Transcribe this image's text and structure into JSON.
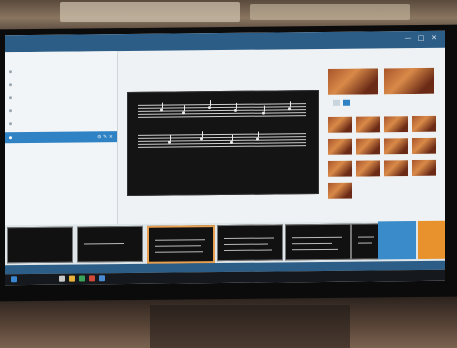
{
  "app": {
    "title": "",
    "window_controls": [
      "—",
      "□",
      "✕"
    ]
  },
  "sidebar": {
    "header": "",
    "items": [
      {
        "label": ""
      },
      {
        "label": ""
      },
      {
        "label": ""
      },
      {
        "label": ""
      },
      {
        "label": ""
      },
      {
        "label": "",
        "active": true,
        "actions": "⚙ ✎ ✕"
      }
    ],
    "sub_items": [
      {
        "label": ""
      },
      {
        "label": ""
      },
      {
        "label": ""
      },
      {
        "label": ""
      },
      {
        "label": ""
      }
    ]
  },
  "preview": {
    "header": "",
    "tools": "",
    "slide_title": "",
    "lyrics": [
      "",
      "",
      ""
    ]
  },
  "thumbnails": {
    "header": "",
    "count": 15
  },
  "strip": {
    "slides": [
      "",
      "",
      "",
      "",
      "",
      ""
    ]
  },
  "buttons": {
    "prev": "",
    "next": ""
  },
  "status": {
    "text": ""
  },
  "taskbar": {
    "clock": ""
  },
  "colors": {
    "accent": "#2f82c4",
    "titlebar": "#2c5d86",
    "next": "#e8922d"
  }
}
